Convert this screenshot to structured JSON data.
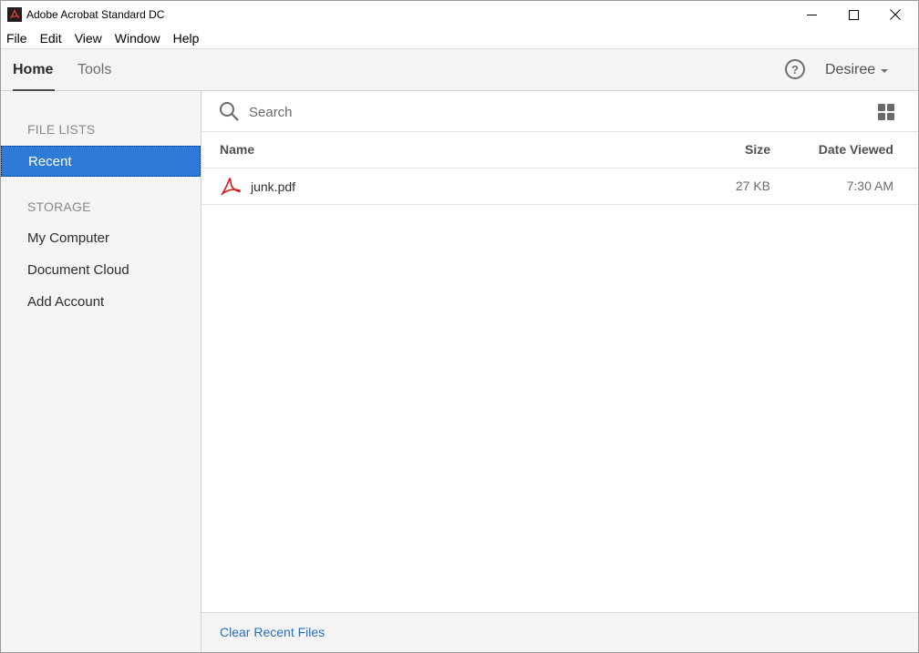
{
  "window": {
    "title": "Adobe Acrobat Standard DC",
    "icon": "acrobat-icon",
    "controls": [
      "minimize-icon",
      "maximize-icon",
      "close-icon"
    ]
  },
  "menubar": {
    "items": [
      "File",
      "Edit",
      "View",
      "Window",
      "Help"
    ]
  },
  "navbar": {
    "tabs": [
      "Home",
      "Tools"
    ],
    "active_tab": "Home",
    "help_icon": "?",
    "user_name": "Desiree"
  },
  "sidebar": {
    "file_lists_heading": "FILE LISTS",
    "recent_label": "Recent",
    "storage_heading": "STORAGE",
    "storage_items": [
      "My Computer",
      "Document Cloud",
      "Add Account"
    ]
  },
  "main": {
    "search_placeholder": "Search",
    "columns": {
      "name": "Name",
      "size": "Size",
      "date": "Date Viewed"
    },
    "files": [
      {
        "name": "junk.pdf",
        "size": "27 KB",
        "date_viewed": "7:30 AM",
        "icon": "pdf-icon"
      }
    ],
    "clear_label": "Clear Recent Files"
  },
  "colors": {
    "accent": "#2d7ad7",
    "link": "#2a6db8",
    "pdf_red": "#d31c1c",
    "panel": "#f4f4f4"
  }
}
